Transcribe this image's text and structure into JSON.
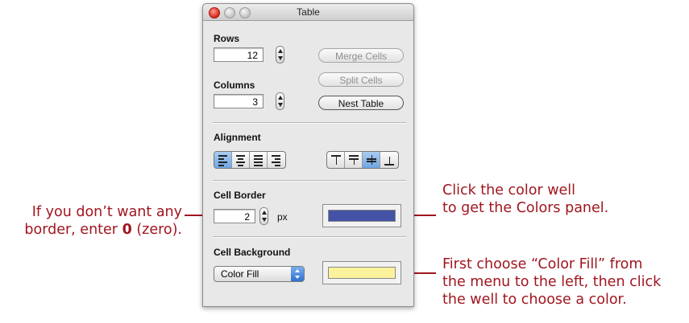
{
  "window": {
    "title": "Table"
  },
  "rows": {
    "label": "Rows",
    "value": "12"
  },
  "columns": {
    "label": "Columns",
    "value": "3"
  },
  "buttons": {
    "merge": "Merge Cells",
    "split": "Split Cells",
    "nest": "Nest Table"
  },
  "alignment": {
    "label": "Alignment",
    "horizontal": [
      "align-left-icon",
      "align-center-icon",
      "align-justify-icon",
      "align-right-icon"
    ],
    "horizontal_selected": 0,
    "vertical": [
      "valign-top-icon",
      "valign-middle-icon",
      "valign-center-icon",
      "valign-bottom-icon"
    ],
    "vertical_selected": 2
  },
  "cell_border": {
    "label": "Cell Border",
    "value": "2",
    "unit": "px",
    "color": "#4452a6"
  },
  "cell_background": {
    "label": "Cell Background",
    "popup_value": "Color Fill",
    "color": "#fdf29c"
  },
  "callouts": {
    "border_line1": "If you don’t want any",
    "border_line2_pre": "border, enter ",
    "border_line2_bold": "0",
    "border_line2_post": " (zero).",
    "well_line1": "Click the color well",
    "well_line2": "to get the Colors panel.",
    "fill_line1": "First choose “Color Fill” from",
    "fill_line2": "the menu to the left, then click",
    "fill_line3": "the well to choose a color."
  },
  "colors": {
    "callout": "#a0161f"
  }
}
